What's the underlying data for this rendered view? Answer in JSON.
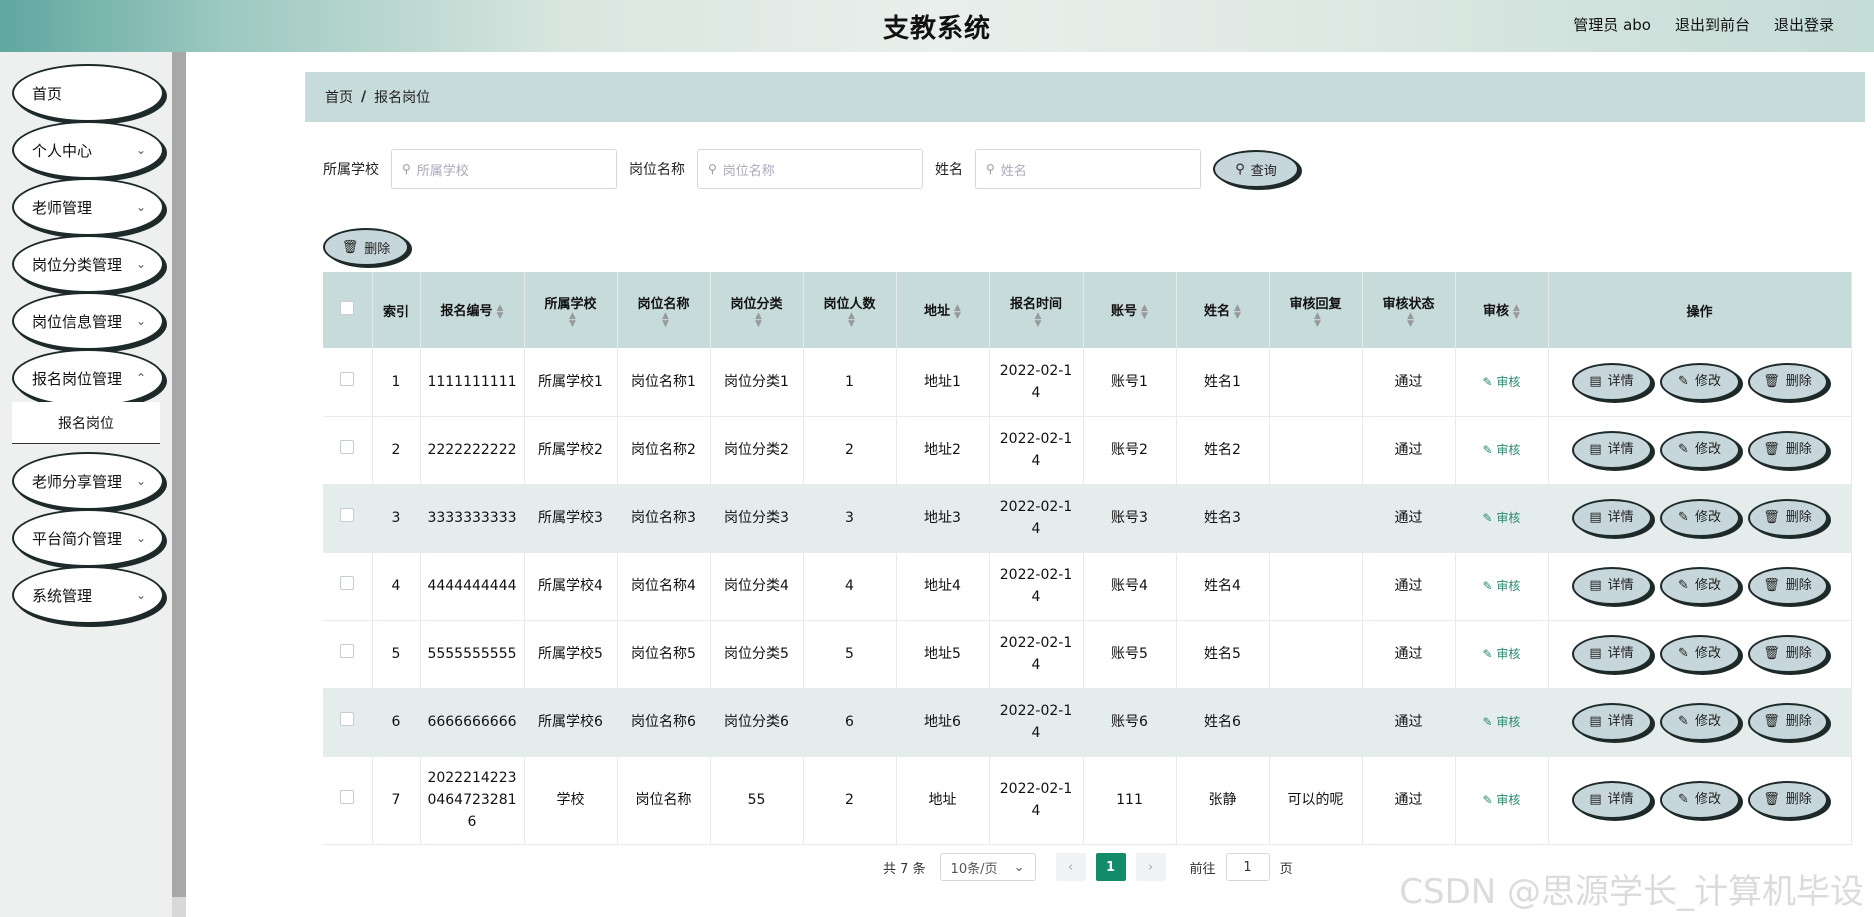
{
  "header": {
    "title": "支教系统",
    "user": "管理员 abo",
    "to_front": "退出到前台",
    "logout": "退出登录"
  },
  "sidebar": {
    "items": [
      {
        "label": "首页",
        "expandable": false
      },
      {
        "label": "个人中心",
        "expandable": true
      },
      {
        "label": "老师管理",
        "expandable": true
      },
      {
        "label": "岗位分类管理",
        "expandable": true
      },
      {
        "label": "岗位信息管理",
        "expandable": true
      },
      {
        "label": "报名岗位管理",
        "expandable": true
      },
      {
        "label": "老师分享管理",
        "expandable": true
      },
      {
        "label": "平台简介管理",
        "expandable": true
      },
      {
        "label": "系统管理",
        "expandable": true
      }
    ],
    "active_sub": "报名岗位"
  },
  "breadcrumb": {
    "home": "首页",
    "sep": "/",
    "current": "报名岗位"
  },
  "search": {
    "school_label": "所属学校",
    "school_placeholder": "所属学校",
    "post_label": "岗位名称",
    "post_placeholder": "岗位名称",
    "name_label": "姓名",
    "name_placeholder": "姓名",
    "query_btn": "查询"
  },
  "toolbar": {
    "delete_btn": "删除"
  },
  "table": {
    "headers": [
      "索引",
      "报名编号",
      "所属学校",
      "岗位名称",
      "岗位分类",
      "岗位人数",
      "地址",
      "报名时间",
      "账号",
      "姓名",
      "审核回复",
      "审核状态",
      "审核",
      "操作"
    ],
    "audit_link": "审核",
    "ops": {
      "detail": "详情",
      "edit": "修改",
      "delete": "删除"
    },
    "rows": [
      {
        "idx": "1",
        "no": "1111111111",
        "school": "所属学校1",
        "post": "岗位名称1",
        "cat": "岗位分类1",
        "count": "1",
        "addr": "地址1",
        "time": "2022-02-14",
        "account": "账号1",
        "name": "姓名1",
        "reply": "",
        "status": "通过"
      },
      {
        "idx": "2",
        "no": "2222222222",
        "school": "所属学校2",
        "post": "岗位名称2",
        "cat": "岗位分类2",
        "count": "2",
        "addr": "地址2",
        "time": "2022-02-14",
        "account": "账号2",
        "name": "姓名2",
        "reply": "",
        "status": "通过"
      },
      {
        "idx": "3",
        "no": "3333333333",
        "school": "所属学校3",
        "post": "岗位名称3",
        "cat": "岗位分类3",
        "count": "3",
        "addr": "地址3",
        "time": "2022-02-14",
        "account": "账号3",
        "name": "姓名3",
        "reply": "",
        "status": "通过"
      },
      {
        "idx": "4",
        "no": "4444444444",
        "school": "所属学校4",
        "post": "岗位名称4",
        "cat": "岗位分类4",
        "count": "4",
        "addr": "地址4",
        "time": "2022-02-14",
        "account": "账号4",
        "name": "姓名4",
        "reply": "",
        "status": "通过"
      },
      {
        "idx": "5",
        "no": "5555555555",
        "school": "所属学校5",
        "post": "岗位名称5",
        "cat": "岗位分类5",
        "count": "5",
        "addr": "地址5",
        "time": "2022-02-14",
        "account": "账号5",
        "name": "姓名5",
        "reply": "",
        "status": "通过"
      },
      {
        "idx": "6",
        "no": "6666666666",
        "school": "所属学校6",
        "post": "岗位名称6",
        "cat": "岗位分类6",
        "count": "6",
        "addr": "地址6",
        "time": "2022-02-14",
        "account": "账号6",
        "name": "姓名6",
        "reply": "",
        "status": "通过"
      },
      {
        "idx": "7",
        "no": "20222142230464723281 6",
        "school": "学校",
        "post": "岗位名称",
        "cat": "55",
        "count": "2",
        "addr": "地址",
        "time": "2022-02-14",
        "account": "111",
        "name": "张静",
        "reply": "可以的呢",
        "status": "通过"
      }
    ]
  },
  "pager": {
    "total": "共 7 条",
    "page_size": "10条/页",
    "current": "1",
    "goto": "前往",
    "goto_value": "1",
    "page_unit": "页"
  },
  "watermark": "CSDN @思源学长_计算机毕设",
  "colors": {
    "accent": "#138a6a",
    "header_bg": "#c8dbdb",
    "button_bg": "#c6d6da"
  }
}
